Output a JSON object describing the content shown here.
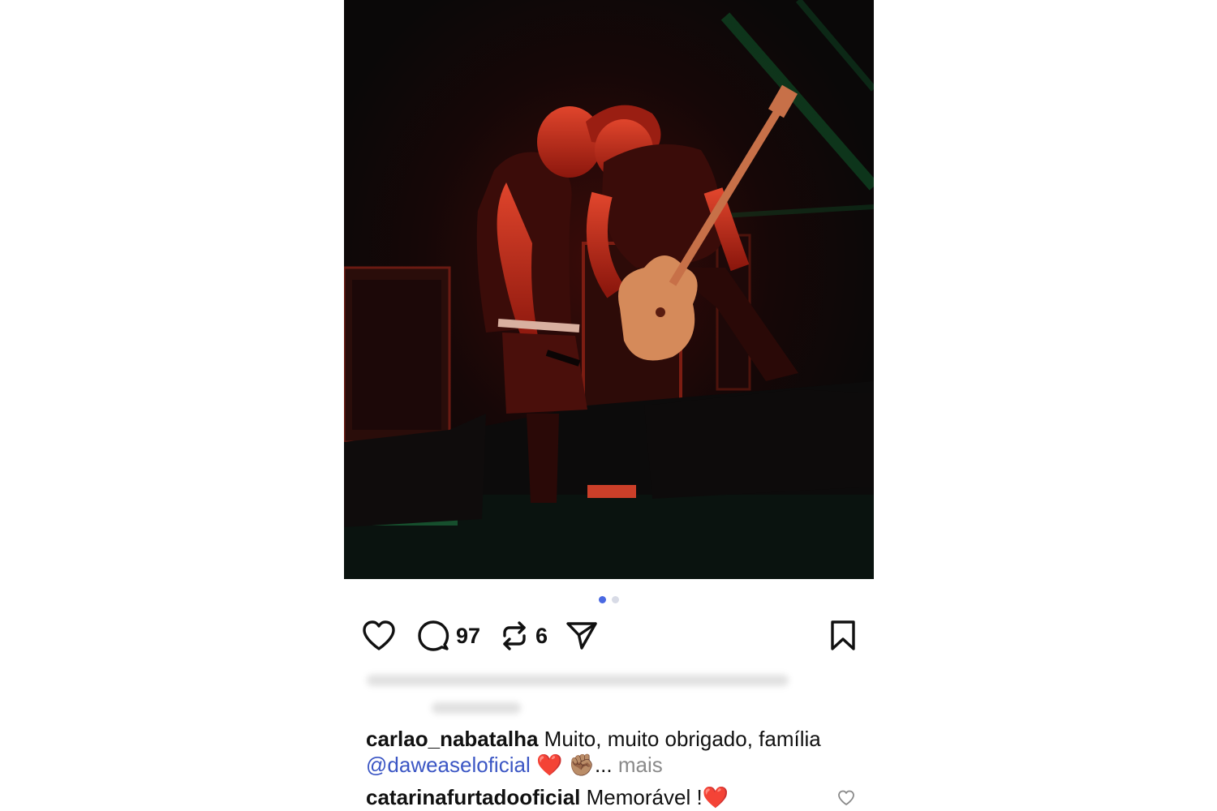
{
  "post": {
    "photo": {
      "alt_subject": "concert-photo",
      "tint": "#b3130f"
    },
    "carousel": {
      "total": 2,
      "active_index": 0,
      "active_color": "#4a69e2",
      "inactive_color": "#d8dbe6"
    },
    "actions": {
      "like_icon": "heart-icon",
      "comment_icon": "comment-bubble-icon",
      "comment_count": "97",
      "repost_icon": "repost-icon",
      "repost_count": "6",
      "share_icon": "send-icon",
      "save_icon": "bookmark-icon"
    },
    "caption": {
      "username": "carlao_nabatalha",
      "text": "Muito, muito obrigado, família",
      "mention": "@daweaseloficial",
      "emojis": "❤️ ✊🏽",
      "ellipsis": "...",
      "more_label": "mais"
    },
    "top_comment": {
      "username": "catarinafurtadooficial",
      "text": "Memorável !",
      "emoji": "❤️",
      "like_icon": "heart-outline-icon"
    }
  }
}
